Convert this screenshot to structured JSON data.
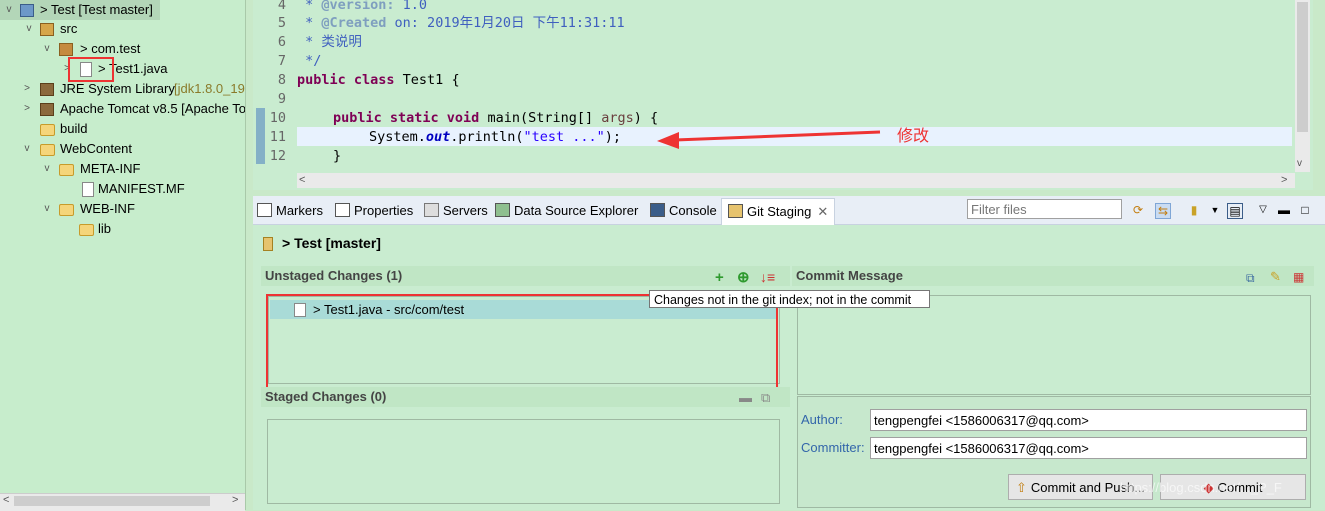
{
  "explorer": {
    "items": [
      {
        "twist": "v",
        "label": "> Test [Test master]"
      },
      {
        "twist": "v",
        "label": "src"
      },
      {
        "twist": "v",
        "label": "> com.test"
      },
      {
        "twist": ">",
        "label": "> Test1.java"
      },
      {
        "twist": ">",
        "label": "JRE System Library",
        "suffix": "[jdk1.8.0_19"
      },
      {
        "twist": ">",
        "label": "Apache Tomcat v8.5 [Apache To"
      },
      {
        "twist": "",
        "label": "build"
      },
      {
        "twist": "v",
        "label": "WebContent"
      },
      {
        "twist": "v",
        "label": "META-INF"
      },
      {
        "twist": "",
        "label": "MANIFEST.MF"
      },
      {
        "twist": "v",
        "label": "WEB-INF"
      },
      {
        "twist": "",
        "label": "lib"
      }
    ]
  },
  "editor": {
    "line_numbers": [
      "4",
      "5",
      "6",
      "7",
      "8",
      "9",
      "10",
      "11",
      "12"
    ],
    "lines": {
      "l4_a": " * ",
      "l4_b": "@version:",
      "l4_c": " 1.0",
      "l5_a": " * ",
      "l5_b": "@Created",
      "l5_c": " on: 2019年1月20日 下午11:31:11",
      "l6": " * 类说明",
      "l7": " */",
      "l8_kw": "public class",
      "l8_rest": " Test1 {",
      "l10_kw": "public static void",
      "l10_mid": " main(String[] ",
      "l10_par": "args",
      "l10_end": ") {",
      "l11_a": "System.",
      "l11_out": "out",
      "l11_b": ".println(",
      "l11_str": "\"test ...\"",
      "l11_c": ");",
      "l12": "}"
    },
    "annotation": "修改"
  },
  "views": {
    "tabs": [
      "Markers",
      "Properties",
      "Servers",
      "Data Source Explorer",
      "Console",
      "Git Staging"
    ],
    "filter_placeholder": "Filter files"
  },
  "staging": {
    "title": "> Test [master]",
    "unstaged_header": "Unstaged Changes (1)",
    "unstaged_file": "> Test1.java - src/com/test",
    "tooltip": "Changes not in the git index; not in the commit",
    "staged_header": "Staged Changes (0)",
    "commit_header": "Commit Message",
    "author_label": "Author:",
    "author_value": "tengpengfei <1586006317@qq.com>",
    "committer_label": "Committer:",
    "committer_value": "tengpengfei <1586006317@qq.com>",
    "commit_push_button": "Commit and Push...",
    "commit_button": "Commit",
    "watermark": "https://blog.csdn.net/..._P_F"
  },
  "colors": {
    "annotation_red": "#ee3333",
    "selection": "#a9dbd7"
  }
}
